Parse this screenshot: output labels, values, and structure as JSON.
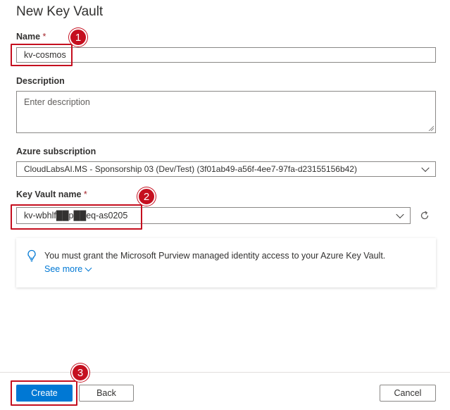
{
  "page": {
    "title": "New Key Vault"
  },
  "name": {
    "label": "Name",
    "required_mark": "*",
    "value": "kv-cosmos"
  },
  "description": {
    "label": "Description",
    "placeholder": "Enter description",
    "value": ""
  },
  "subscription": {
    "label": "Azure subscription",
    "value": "CloudLabsAI.MS - Sponsorship 03 (Dev/Test) (3f01ab49-a56f-4ee7-97fa-d23155156b42)"
  },
  "key_vault_name": {
    "label": "Key Vault name",
    "required_mark": "*",
    "value": "kv-wbhlf██p██eq-as0205"
  },
  "info": {
    "message": "You must grant the Microsoft Purview managed identity access to your Azure Key Vault.",
    "see_more": "See more",
    "icon": "lightbulb-icon"
  },
  "footer": {
    "create_label": "Create",
    "back_label": "Back",
    "cancel_label": "Cancel"
  },
  "annotations": {
    "step1": "1",
    "step2": "2",
    "step3": "3"
  },
  "colors": {
    "accent": "#0078d4",
    "highlight": "#c50f1f",
    "required": "#a4262c"
  }
}
